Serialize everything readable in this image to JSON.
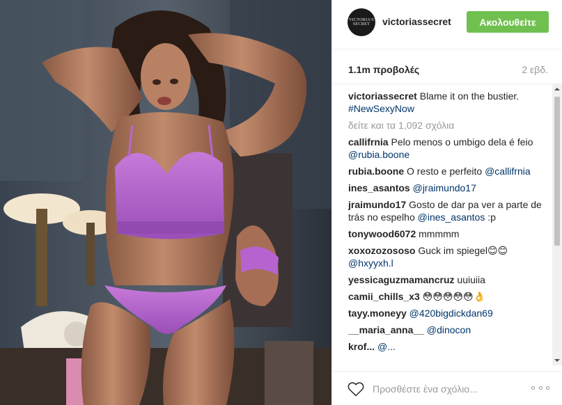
{
  "post": {
    "username": "victoriassecret",
    "avatar_text": [
      "VICTORIA'S",
      "SECRET"
    ],
    "follow_label": "Ακολουθείτε",
    "views": "1.1m προβολές",
    "age": "2 εβδ."
  },
  "caption": {
    "username": "victoriassecret",
    "text": " Blame it on the bustier. ",
    "hashtag": "#NewSexyNow"
  },
  "load_more": "δείτε και τα 1,092 σχόλια",
  "comments": [
    {
      "user": "callifrnia",
      "text": " Pelo menos o umbigo dela é feio ",
      "mention": "@rubia.boone",
      "after": ""
    },
    {
      "user": "rubia.boone",
      "text": " O resto e perfeito ",
      "mention": "@callifrnia",
      "after": ""
    },
    {
      "user": "ines_asantos",
      "text": " ",
      "mention": "@jraimundo17",
      "after": ""
    },
    {
      "user": "jraimundo17",
      "text": " Gosto de dar pa ver a parte de trás no espelho ",
      "mention": "@ines_asantos",
      "after": " :p"
    },
    {
      "user": "tonywood6072",
      "text": " mmmmm",
      "mention": "",
      "after": ""
    },
    {
      "user": "xoxozozososo",
      "text": " Guck im spiegel😊😊 ",
      "mention": "@hxyyxh.l",
      "after": ""
    },
    {
      "user": "yessicaguzmamancruz",
      "text": " uuiuiia",
      "mention": "",
      "after": ""
    },
    {
      "user": "camii_chills_x3",
      "text": " 😳😳😳😳😳👌",
      "mention": "",
      "after": ""
    },
    {
      "user": "tayy.moneyy",
      "text": " ",
      "mention": "@420bigdickdan69",
      "after": ""
    },
    {
      "user": "__maria_anna__",
      "text": " ",
      "mention": "@dinocon",
      "after": ""
    },
    {
      "user": "krof...",
      "text": " ",
      "mention": "@...",
      "after": ""
    }
  ],
  "footer": {
    "comment_placeholder": "Προσθέστε ένα σχόλιο..."
  },
  "icons": {
    "heart": "heart-outline-icon",
    "more": "more-options-icon"
  },
  "colors": {
    "follow_button": "#70c050",
    "link": "#003569",
    "muted": "#999999",
    "text": "#262626"
  }
}
